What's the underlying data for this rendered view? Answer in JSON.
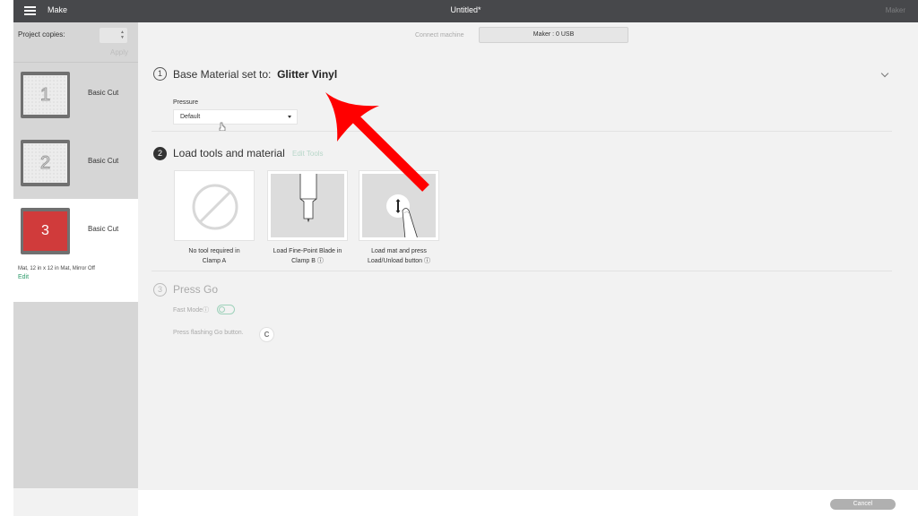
{
  "topbar": {
    "menu_icon": "hamburger-icon",
    "section": "Make",
    "title": "Untitled*",
    "machine": "Maker"
  },
  "sidebar": {
    "copies_label": "Project copies:",
    "copies_value": "",
    "apply_label": "Apply",
    "mats": [
      {
        "number": "1",
        "label": "Basic Cut",
        "active": false
      },
      {
        "number": "2",
        "label": "Basic Cut",
        "active": false
      },
      {
        "number": "3",
        "label": "Basic Cut",
        "active": true,
        "info": "Mat, 12 in x 12 in Mat, Mirror Off",
        "edit_label": "Edit"
      }
    ]
  },
  "connect": {
    "label": "Connect machine",
    "button": "Maker : 0 USB"
  },
  "steps": {
    "step1": {
      "number": "1",
      "title": "Base Material set to:",
      "material": "Glitter Vinyl",
      "pressure_label": "Pressure",
      "pressure_value": "Default"
    },
    "step2": {
      "number": "2",
      "title": "Load tools and material",
      "edit_tools": "Edit Tools",
      "cards": [
        {
          "icon": "no-tool-icon",
          "caption_line1": "No tool required in",
          "caption_line2": "Clamp A"
        },
        {
          "icon": "fine-point-blade-icon",
          "caption_line1": "Load Fine-Point Blade in",
          "caption_line2": "Clamp B ⓘ"
        },
        {
          "icon": "load-unload-button-icon",
          "caption_line1": "Load mat and press",
          "caption_line2": "Load/Unload button ⓘ"
        }
      ]
    },
    "step3": {
      "number": "3",
      "title": "Press Go",
      "fast_mode_label": "Fast Modeⓘ",
      "fast_mode_on": false,
      "go_text": "Press flashing Go button.",
      "go_glyph": "C"
    }
  },
  "footer": {
    "cancel_label": "Cancel"
  },
  "annotation": {
    "arrow_color": "#ff0000"
  }
}
